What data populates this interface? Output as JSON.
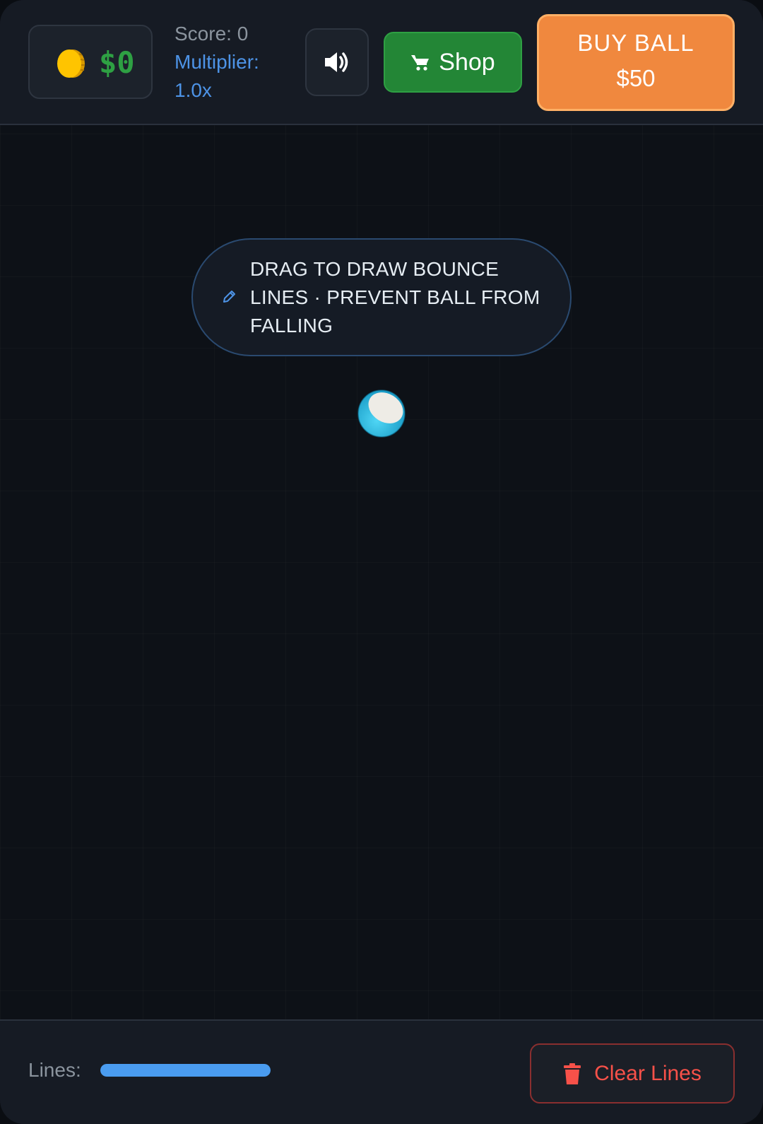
{
  "header": {
    "money": "$0",
    "score": "Score: 0",
    "multiplier_label": "Multiplier:",
    "multiplier_value": "1.0x",
    "shop_label": "Shop",
    "buy_label": "BUY BALL",
    "buy_price": "$50"
  },
  "hint": {
    "text": "DRAG TO DRAW BOUNCE LINES · PREVENT BALL FROM FALLING"
  },
  "footer": {
    "lines_label": "Lines:",
    "lines_fraction": 1.0,
    "clear_label": "Clear Lines"
  },
  "icons": {
    "coin": "coin-icon",
    "sound": "speaker-icon",
    "shop": "cart-icon",
    "hint": "pencil-icon",
    "clear": "trash-icon"
  },
  "colors": {
    "money": "#2ea043",
    "multiplier": "#4d93e6",
    "shop_button": "#238636",
    "buy_button": "#f0883e",
    "lines_meter": "#4a9cf0",
    "clear_button_text": "#f85149",
    "ball": "#22b8e0"
  }
}
